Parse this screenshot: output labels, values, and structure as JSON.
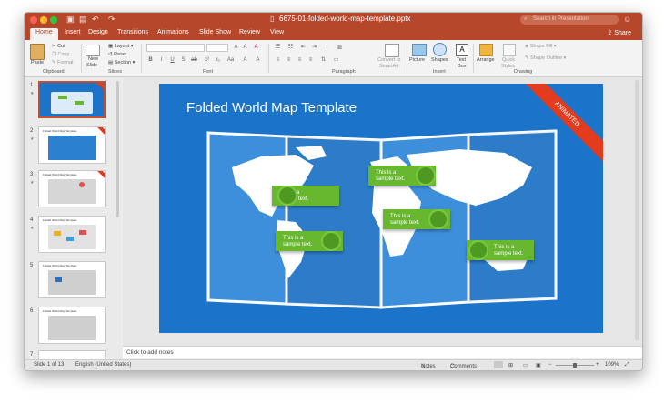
{
  "window": {
    "title": "6675-01-folded-world-map-template.pptx",
    "search_placeholder": "Search in Presentation",
    "share_label": "Share"
  },
  "tabs": [
    {
      "label": "Home",
      "active": true
    },
    {
      "label": "Insert"
    },
    {
      "label": "Design"
    },
    {
      "label": "Transitions"
    },
    {
      "label": "Animations"
    },
    {
      "label": "Slide Show"
    },
    {
      "label": "Review"
    },
    {
      "label": "View"
    }
  ],
  "ribbon": {
    "paste": "Paste",
    "cut": "Cut",
    "copy": "Copy",
    "format": "Format",
    "new_slide_1": "New",
    "new_slide_2": "Slide",
    "layout": "Layout",
    "reset": "Reset",
    "section": "Section",
    "convert_1": "Convert to",
    "convert_2": "SmartArt",
    "picture": "Picture",
    "shapes": "Shapes",
    "textbox_1": "Text",
    "textbox_2": "Box",
    "arrange": "Arrange",
    "quick_1": "Quick",
    "quick_2": "Styles",
    "shape_fill": "Shape Fill",
    "shape_outline": "Shape Outline",
    "groups": {
      "clipboard": "Clipboard",
      "slides": "Slides",
      "font": "Font",
      "paragraph": "Paragraph",
      "insert": "Insert",
      "drawing": "Drawing"
    }
  },
  "thumbnails": [
    {
      "num": "1",
      "title": "Folded World Map Template",
      "selected": true
    },
    {
      "num": "2",
      "title": "Folded World Map Template"
    },
    {
      "num": "3",
      "title": "Folded World Map Template"
    },
    {
      "num": "4",
      "title": "Folded World Map Template"
    },
    {
      "num": "5",
      "title": "Folded World Map Template"
    },
    {
      "num": "6",
      "title": "Folded World Map Template"
    },
    {
      "num": "7",
      "title": ""
    }
  ],
  "slide": {
    "title": "Folded World Map Template",
    "corner_label": "ANIMATED",
    "callouts": [
      {
        "line1": "This is a",
        "line2": "sample text."
      },
      {
        "line1": "This is a",
        "line2": "sample text."
      },
      {
        "line1": "This is a",
        "line2": "sample text."
      },
      {
        "line1": "This is a",
        "line2": "sample text."
      },
      {
        "line1": "This is a",
        "line2": "sample text."
      }
    ]
  },
  "notes_placeholder": "Click to add notes",
  "status": {
    "slide_info": "Slide 1 of 13",
    "language": "English (United States)",
    "notes": "Notes",
    "comments": "Comments",
    "zoom": "109%"
  },
  "colors": {
    "accent": "#b7472a",
    "slide_bg": "#1b74c9",
    "callout": "#67b82f",
    "corner": "#e33b1d"
  }
}
